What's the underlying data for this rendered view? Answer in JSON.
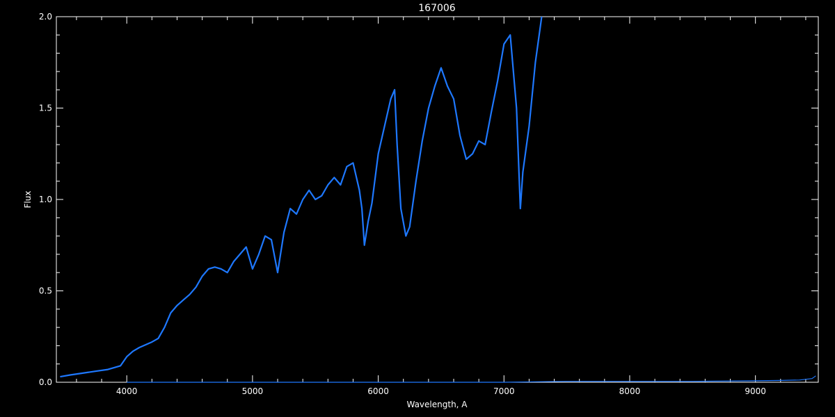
{
  "chart_data": {
    "type": "line",
    "title": "167006",
    "xlabel": "Wavelength, A",
    "ylabel": "Flux",
    "xlim": [
      3440,
      9500
    ],
    "ylim": [
      0.0,
      2.0
    ],
    "x_ticks": [
      "4000",
      "5000",
      "6000",
      "7000",
      "8000",
      "9000"
    ],
    "y_ticks": [
      "0.0",
      "0.5",
      "1.0",
      "1.5",
      "2.0"
    ],
    "x_minor_step": 200,
    "y_minor_step": 0.1,
    "background": "#000000",
    "axis_color": "#ffffff",
    "series": [
      {
        "color": "#1e78ff",
        "x": [
          3470,
          3550,
          3650,
          3750,
          3850,
          3950,
          4000,
          4050,
          4100,
          4200,
          4250,
          4300,
          4350,
          4400,
          4450,
          4500,
          4550,
          4600,
          4650,
          4700,
          4750,
          4800,
          4850,
          4900,
          4950,
          5000,
          5050,
          5100,
          5150,
          5200,
          5250,
          5300,
          5350,
          5400,
          5450,
          5500,
          5550,
          5600,
          5650,
          5700,
          5750,
          5800,
          5850,
          5870,
          5890,
          5920,
          5950,
          6000,
          6050,
          6100,
          6130,
          6150,
          6180,
          6220,
          6250,
          6300,
          6350,
          6400,
          6450,
          6500,
          6550,
          6600,
          6650,
          6700,
          6750,
          6800,
          6850,
          6900,
          6950,
          7000,
          7050,
          7100,
          7130,
          7150,
          7200,
          7250,
          7300
        ],
        "y": [
          0.03,
          0.04,
          0.05,
          0.06,
          0.07,
          0.09,
          0.14,
          0.17,
          0.19,
          0.22,
          0.24,
          0.3,
          0.38,
          0.42,
          0.45,
          0.48,
          0.52,
          0.58,
          0.62,
          0.63,
          0.62,
          0.6,
          0.66,
          0.7,
          0.74,
          0.62,
          0.7,
          0.8,
          0.78,
          0.6,
          0.82,
          0.95,
          0.92,
          1.0,
          1.05,
          1.0,
          1.02,
          1.08,
          1.12,
          1.08,
          1.18,
          1.2,
          1.05,
          0.95,
          0.75,
          0.88,
          0.98,
          1.25,
          1.4,
          1.55,
          1.6,
          1.3,
          0.95,
          0.8,
          0.85,
          1.1,
          1.32,
          1.5,
          1.62,
          1.72,
          1.62,
          1.55,
          1.35,
          1.22,
          1.25,
          1.32,
          1.3,
          1.48,
          1.65,
          1.85,
          1.9,
          1.5,
          0.95,
          1.15,
          1.4,
          1.75,
          2.0
        ]
      },
      {
        "color": "#1e78ff",
        "x": [
          4000,
          5000,
          6000,
          7000,
          7500,
          8000,
          8500,
          9000,
          9200,
          9350,
          9450,
          9480
        ],
        "y": [
          0.0,
          0.0,
          0.0,
          0.0,
          0.005,
          0.005,
          0.005,
          0.008,
          0.01,
          0.012,
          0.02,
          0.035
        ]
      }
    ]
  }
}
